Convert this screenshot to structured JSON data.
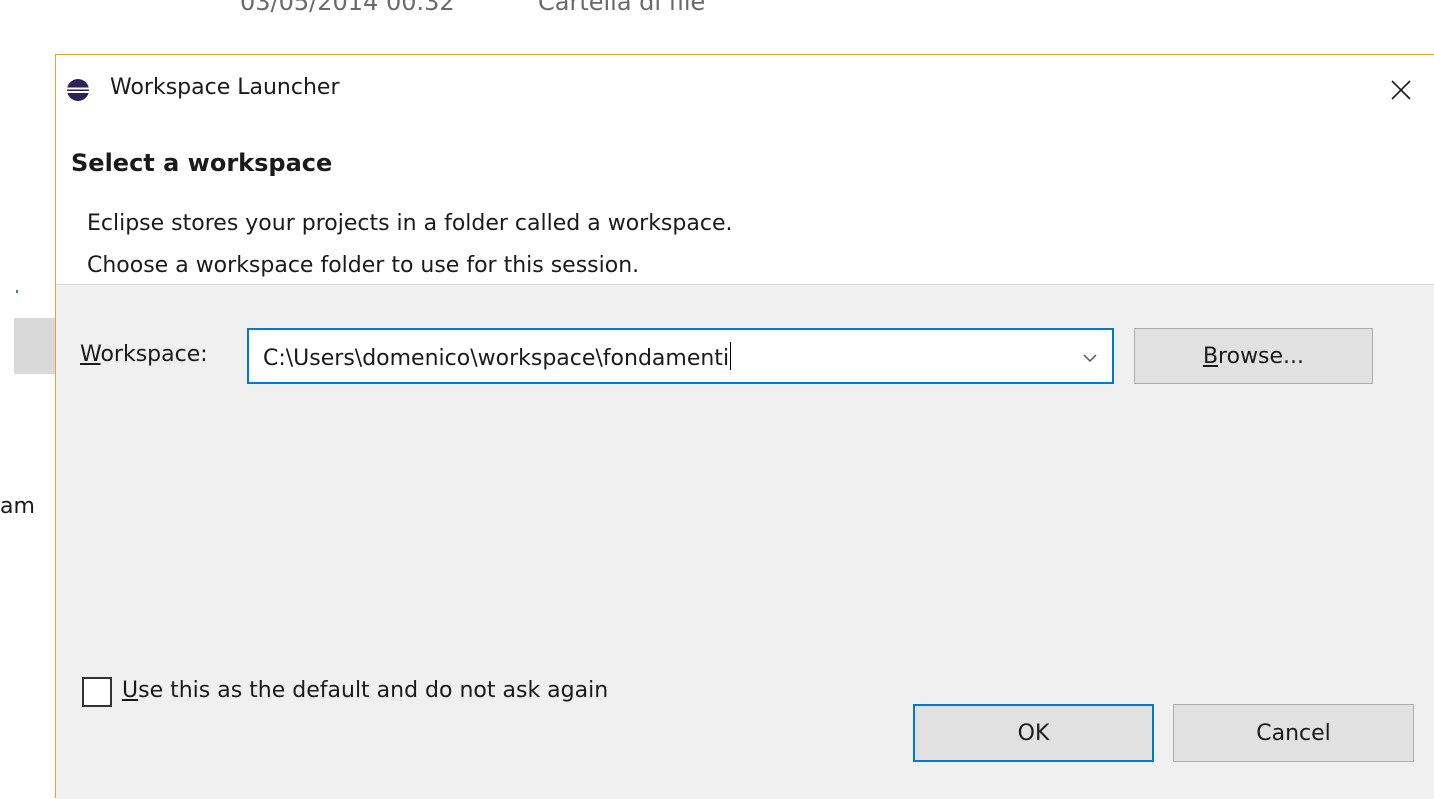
{
  "background": {
    "date_text": "03/05/2014 00.32",
    "type_text": "Cartella di file",
    "fragment_text": "am"
  },
  "dialog": {
    "title": "Workspace Launcher",
    "heading": "Select a workspace",
    "description_line1": "Eclipse stores your projects in a folder called a workspace.",
    "description_line2": "Choose a workspace folder to use for this session.",
    "workspace_label_mnemonic": "W",
    "workspace_label_rest": "orkspace:",
    "workspace_value": "C:\\Users\\domenico\\workspace\\fondamenti",
    "browse_mnemonic": "B",
    "browse_rest": "rowse...",
    "checkbox_mnemonic": "U",
    "checkbox_rest": "se this as the default and do not ask again",
    "checkbox_checked": false,
    "ok_label": "OK",
    "cancel_label": "Cancel"
  },
  "colors": {
    "accent": "#0078d7",
    "window_border": "#e6a03c",
    "button_face": "#e1e1e1",
    "dialog_body": "#f0f0f0"
  },
  "icons": {
    "app": "eclipse-icon",
    "close": "close-icon",
    "dropdown": "chevron-down-icon"
  }
}
